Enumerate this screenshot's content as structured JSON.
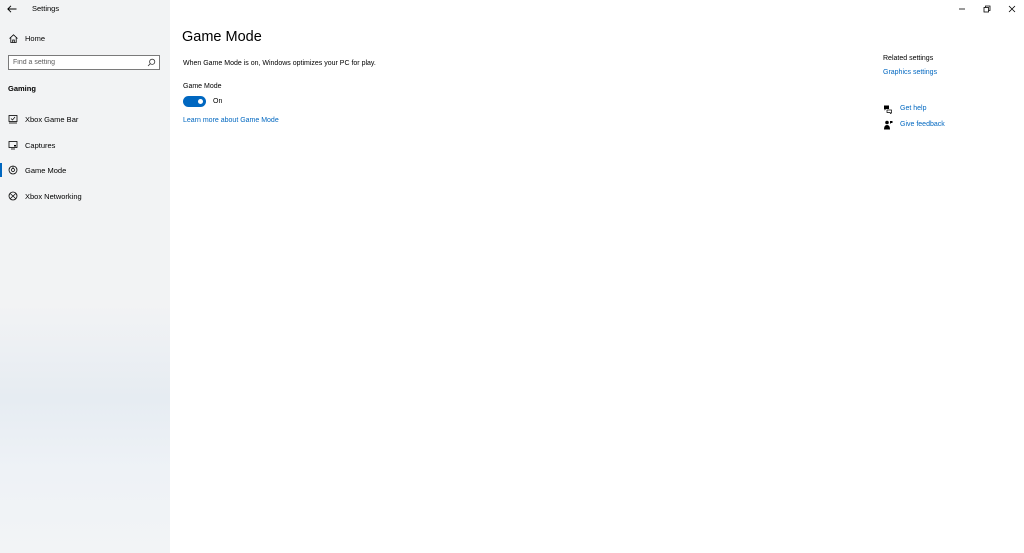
{
  "app": {
    "title": "Settings"
  },
  "sidebar": {
    "home_label": "Home",
    "search_placeholder": "Find a setting",
    "section_heading": "Gaming",
    "items": [
      {
        "label": "Xbox Game Bar",
        "icon": "xbox-game-bar-icon",
        "selected": false
      },
      {
        "label": "Captures",
        "icon": "captures-icon",
        "selected": false
      },
      {
        "label": "Game Mode",
        "icon": "game-mode-icon",
        "selected": true
      },
      {
        "label": "Xbox Networking",
        "icon": "xbox-icon",
        "selected": false
      }
    ]
  },
  "main": {
    "title": "Game Mode",
    "description": "When Game Mode is on, Windows optimizes your PC for play.",
    "toggle_label": "Game Mode",
    "toggle_state": "On",
    "toggle_on": true,
    "learn_more": "Learn more about Game Mode"
  },
  "related": {
    "heading": "Related settings",
    "link": "Graphics settings"
  },
  "help": {
    "get_help": "Get help",
    "give_feedback": "Give feedback"
  },
  "colors": {
    "accent": "#0067c0",
    "sidebar_bg": "#f2f3f4"
  }
}
